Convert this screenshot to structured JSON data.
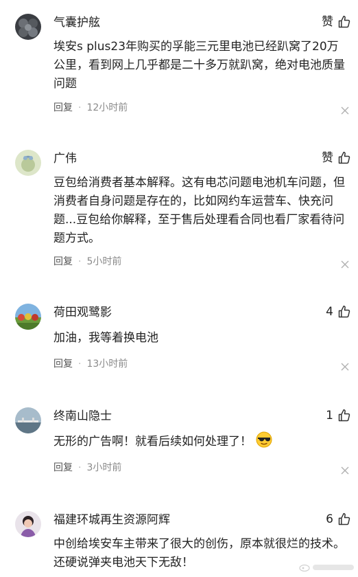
{
  "comments": [
    {
      "username": "气囊护舷",
      "like_label": "赞",
      "text": "埃安s plus23年购买的孚能三元里电池已经趴窝了20万公里，看到网上几乎都是二十多万就趴窝，绝对电池质量问题",
      "reply_label": "回复",
      "time": "12小时前"
    },
    {
      "username": "广伟",
      "like_label": "赞",
      "text": "豆包给消费者基本解释。这有电芯问题电池机车问题，但消费者自身问题是存在的，比如网约车运营车、快充问题...豆包给你解释，至于售后处理看合同也看厂家看待问题方式。",
      "reply_label": "回复",
      "time": "5小时前"
    },
    {
      "username": "荷田观鹭影",
      "like_count": "4",
      "text": "加油，我等着换电池",
      "reply_label": "回复",
      "time": "13小时前"
    },
    {
      "username": "终南山隐士",
      "like_count": "1",
      "text": "无形的广告啊！就看后续如何处理了！",
      "reply_label": "回复",
      "time": "3小时前"
    },
    {
      "username": "福建环城再生资源阿辉",
      "like_count": "6",
      "text": "中创给埃安车主带来了很大的创伤，原本就很烂的技术。还硬说弹夹电池天下无敌！"
    }
  ]
}
